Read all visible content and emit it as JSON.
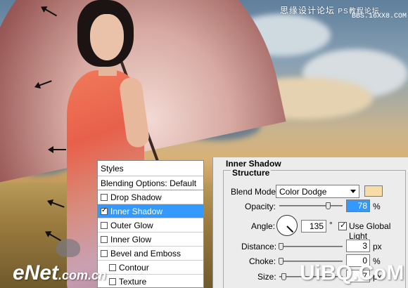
{
  "watermark": {
    "top_line1": "思缘设计论坛",
    "top_line2": "PS教程论坛",
    "top_line3": "BBS.16XX8.COM",
    "enet_main": "eNet",
    "enet_domain": ".com.cn",
    "uibq": "UiBQ.CoM"
  },
  "styles_panel": {
    "title": "Styles",
    "blending": "Blending Options: Default",
    "items": [
      {
        "label": "Drop Shadow",
        "checked": false,
        "selected": false
      },
      {
        "label": "Inner Shadow",
        "checked": true,
        "selected": true
      },
      {
        "label": "Outer Glow",
        "checked": false,
        "selected": false
      },
      {
        "label": "Inner Glow",
        "checked": false,
        "selected": false
      },
      {
        "label": "Bevel and Emboss",
        "checked": false,
        "selected": false
      },
      {
        "label": "Contour",
        "checked": false,
        "selected": false
      },
      {
        "label": "Texture",
        "checked": false,
        "selected": false
      }
    ]
  },
  "inner_shadow": {
    "title": "Inner Shadow",
    "structure": "Structure",
    "blend_mode_label": "Blend Mode:",
    "blend_mode_value": "Color Dodge",
    "swatch_color": "#f6dca8",
    "opacity_label": "Opacity:",
    "opacity_value": "78",
    "opacity_unit": "%",
    "opacity_level": 0.78,
    "angle_label": "Angle:",
    "angle_value": "135",
    "angle_unit": "°",
    "use_global_light_label": "Use Global Light",
    "use_global_light_checked": true,
    "distance_label": "Distance:",
    "distance_value": "3",
    "distance_unit": "px",
    "choke_label": "Choke:",
    "choke_value": "0",
    "choke_unit": "%",
    "size_label": "Size:",
    "size_value": "7",
    "size_unit": "px"
  }
}
